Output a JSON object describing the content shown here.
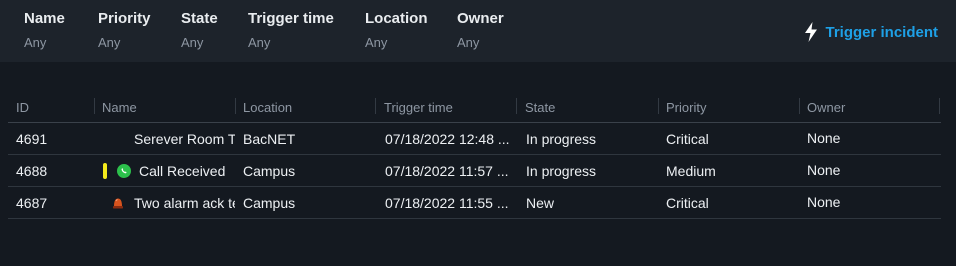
{
  "filters": [
    {
      "label": "Name",
      "value": "Any"
    },
    {
      "label": "Priority",
      "value": "Any"
    },
    {
      "label": "State",
      "value": "Any"
    },
    {
      "label": "Trigger time",
      "value": "Any"
    },
    {
      "label": "Location",
      "value": "Any"
    },
    {
      "label": "Owner",
      "value": "Any"
    }
  ],
  "trigger_button": {
    "label": "Trigger incident",
    "icon": "lightning-bolt-icon"
  },
  "colors": {
    "accent": "#1ea0e6",
    "priority_medium": "#f4ea1c",
    "whatsapp": "#2cc04b"
  },
  "columns": [
    "ID",
    "Name",
    "Location",
    "Trigger time",
    "State",
    "Priority",
    "Owner"
  ],
  "rows": [
    {
      "id": "4691",
      "name": "Serever Room Temperature",
      "location": "BacNET",
      "trigger_time": "07/18/2022 12:48 ...",
      "state": "In progress",
      "priority": "Critical",
      "owner": "None"
    },
    {
      "id": "4688",
      "name": "Call Received",
      "location": "Campus",
      "trigger_time": "07/18/2022 11:57 ...",
      "state": "In progress",
      "priority": "Medium",
      "owner": "None",
      "icon": "whatsapp-icon"
    },
    {
      "id": "4687",
      "name": "Two alarm ack test",
      "location": "Campus",
      "trigger_time": "07/18/2022 11:55 ...",
      "state": "New",
      "priority": "Critical",
      "owner": "None",
      "icon": "alarm-light-icon"
    }
  ]
}
